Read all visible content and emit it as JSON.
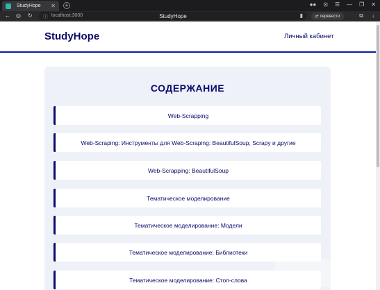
{
  "browser": {
    "tab_title": "StudyHope",
    "tab_close": "✕",
    "new_tab": "+",
    "url": "localhost:3000",
    "page_title": "StudyHope",
    "translate_label": "перевести",
    "window_controls": [
      "⊝",
      "⊡",
      "☰",
      "—",
      "❐",
      "✕"
    ]
  },
  "header": {
    "brand": "StudyHope",
    "account_link": "Личный кабинет"
  },
  "content": {
    "title": "СОДЕРЖАНИЕ",
    "lessons": [
      {
        "label": "Web-Scrapping"
      },
      {
        "label": "Web-Scraping: Инструменты для Web-Scraping: BeautifulSoup, Scrapy и другие"
      },
      {
        "label": "Web-Scrapping: BeautifulSoup"
      },
      {
        "label": "Тематическое моделирование"
      },
      {
        "label": "Тематическое моделирование: Модели"
      },
      {
        "label": "Тематическое моделирование: Библиотеки"
      },
      {
        "label": "Тематическое моделирование: Стоп-слова"
      }
    ]
  },
  "colors": {
    "brand": "#0a0a6b",
    "accent_line": "#0c1aa0",
    "card_bg": "#eef1f7"
  }
}
